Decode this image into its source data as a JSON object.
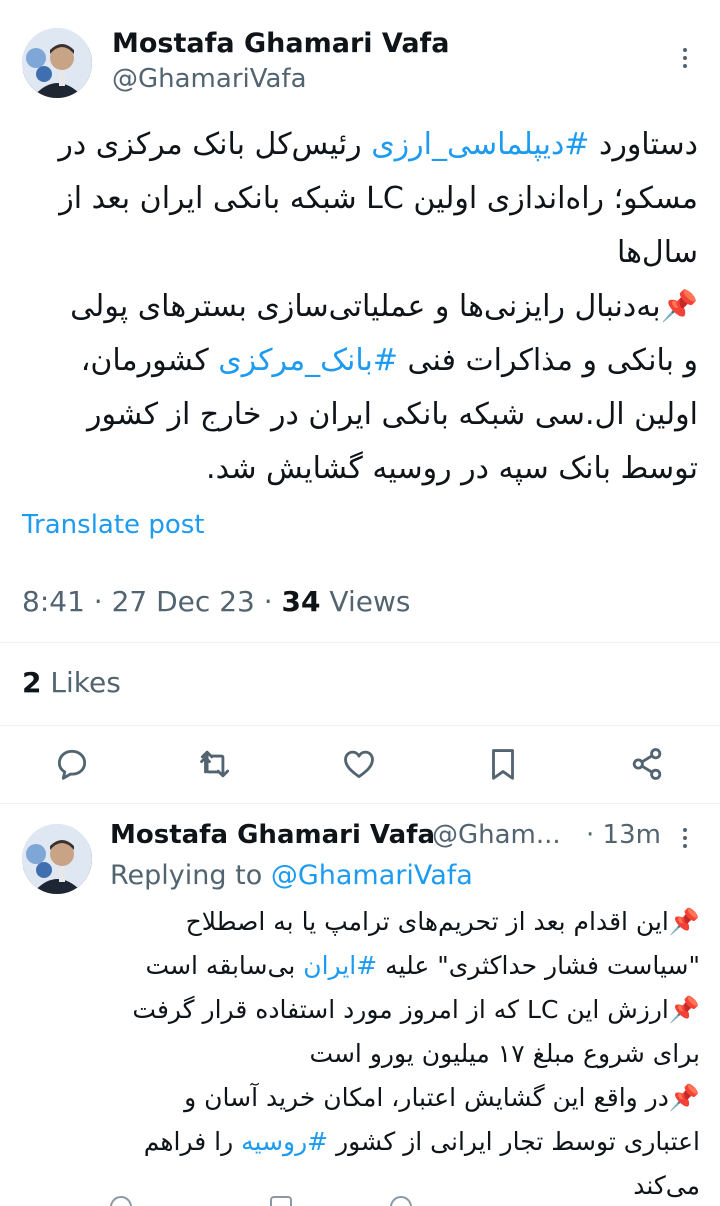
{
  "main_tweet": {
    "display_name": "Mostafa Ghamari Vafa",
    "handle": "@GhamariVafa",
    "lines": [
      [
        {
          "t": "دستاورد "
        },
        {
          "t": "#دیپلماسی_ارزی",
          "tag": true
        },
        {
          "t": " رئیس‌کل بانک مرکزی در"
        }
      ],
      [
        {
          "t": "مسکو؛ راه‌اندازی اولین LC شبکه بانکی ایران بعد از"
        }
      ],
      [
        {
          "t": "سال‌ها"
        }
      ],
      [
        {
          "t": "📌به‌دنبال رایزنی‌ها و عملیاتی‌سازی بسترهای پولی"
        }
      ],
      [
        {
          "t": "و بانکی و مذاکرات فنی "
        },
        {
          "t": "#بانک_مرکزی",
          "tag": true
        },
        {
          "t": " کشورمان،"
        }
      ],
      [
        {
          "t": "اولین ال.سی شبکه بانکی ایران در خارج از کشور"
        }
      ],
      [
        {
          "t": "توسط بانک سپه در روسیه گشایش شد."
        }
      ]
    ],
    "translate_label": "Translate post",
    "time": "8:41 · 27 Dec 23 · ",
    "views_count": "34",
    "views_label": " Views",
    "likes_count": "2",
    "likes_label": " Likes"
  },
  "reply_tweet": {
    "display_name": "Mostafa Ghamari Vafa",
    "handle": "@Gham...",
    "time": "· 13m",
    "replying_prefix": "Replying to ",
    "replying_handle": "@GhamariVafa",
    "lines": [
      [
        {
          "t": "📌این اقدام بعد از تحریم‌های ترامپ یا به اصطلاح"
        }
      ],
      [
        {
          "t": "\"سیاست فشار حداکثری\" علیه "
        },
        {
          "t": "#ایران",
          "tag": true
        },
        {
          "t": " بی‌سابقه است"
        }
      ],
      [
        {
          "t": "📌ارزش این LC که از امروز مورد استفاده قرار گرفت"
        }
      ],
      [
        {
          "t": "برای شروع مبلغ ۱۷ میلیون یورو است"
        }
      ],
      [
        {
          "t": "📌در واقع این گشایش اعتبار، امکان خرید آسان و"
        }
      ],
      [
        {
          "t": "اعتباری توسط تجار ایرانی از کشور "
        },
        {
          "t": "#روسیه",
          "tag": true
        },
        {
          "t": " را فراهم"
        }
      ],
      [
        {
          "t": "می‌کند"
        }
      ]
    ]
  },
  "colors": {
    "accent": "#1d9bf0",
    "text": "#0f1419",
    "secondary": "#536471",
    "divider": "#eff3f4"
  },
  "icons": [
    "more-icon",
    "reply-icon",
    "retweet-icon",
    "like-icon",
    "bookmark-icon",
    "share-icon"
  ]
}
